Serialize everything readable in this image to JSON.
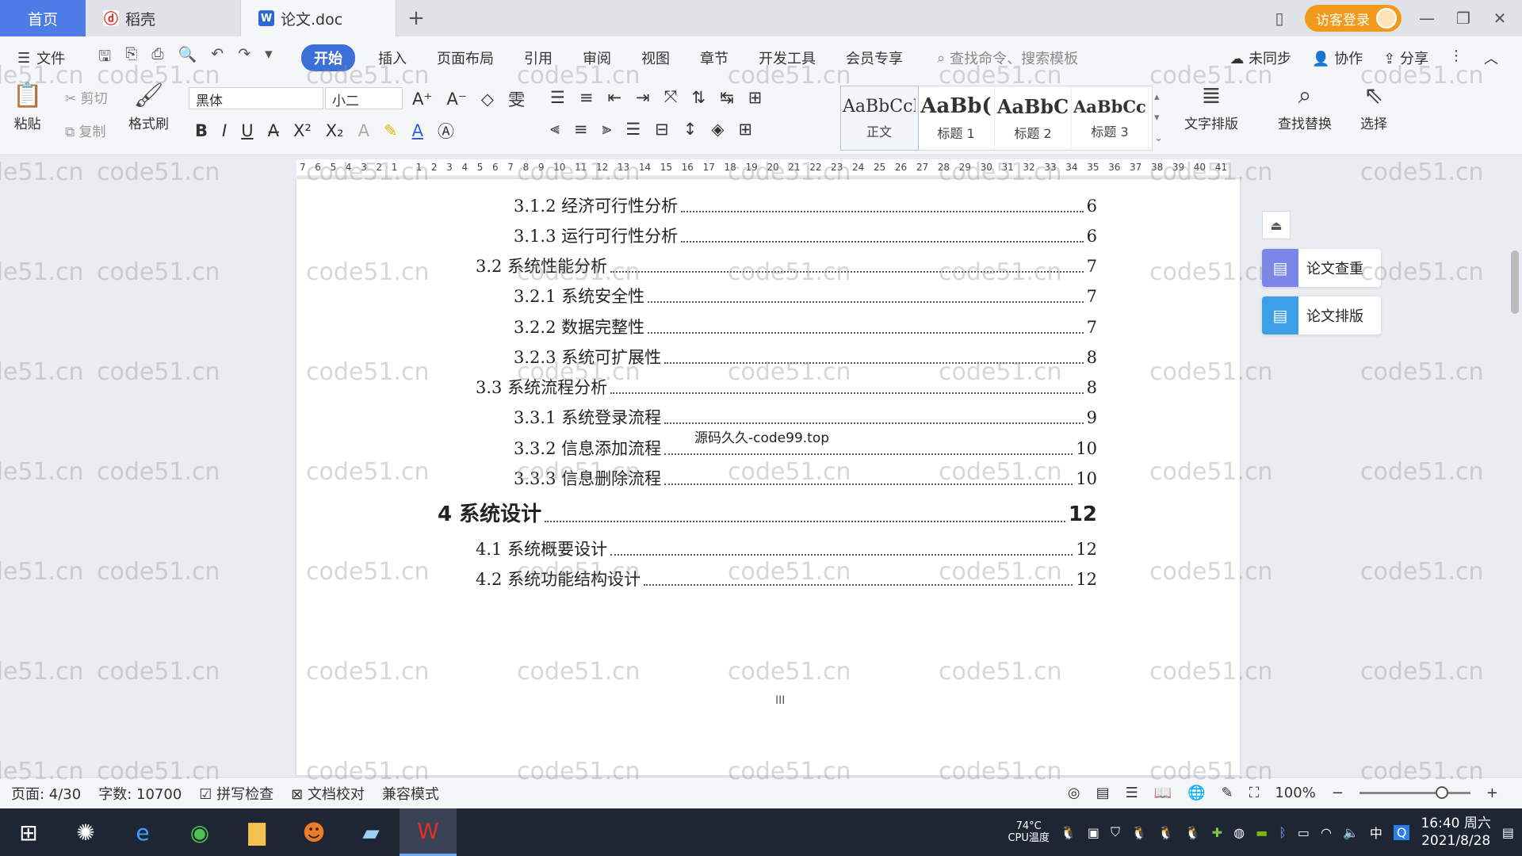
{
  "tabs": {
    "home": "首页",
    "docer": "稻壳",
    "doc": "论文.doc",
    "login": "访客登录"
  },
  "menu": {
    "file": "文件",
    "items": [
      "开始",
      "插入",
      "页面布局",
      "引用",
      "审阅",
      "视图",
      "章节",
      "开发工具",
      "会员专享"
    ],
    "search_placeholder": "查找命令、搜索模板",
    "unsynced": "未同步",
    "collab": "协作",
    "share": "分享"
  },
  "ribbon": {
    "paste": "粘贴",
    "cut": "剪切",
    "copy": "复制",
    "format_painter": "格式刷",
    "font": "黑体",
    "size": "小二",
    "styles": [
      {
        "sample": "AaBbCcI",
        "name": "正文"
      },
      {
        "sample": "AaBb(",
        "name": "标题 1"
      },
      {
        "sample": "AaBbC",
        "name": "标题 2"
      },
      {
        "sample": "AaBbCcI",
        "name": "标题 3"
      }
    ],
    "text_layout": "文字排版",
    "find_replace": "查找替换",
    "select": "选择"
  },
  "ruler": [
    "7",
    "6",
    "5",
    "4",
    "3",
    "2",
    "1",
    "",
    "1",
    "2",
    "3",
    "4",
    "5",
    "6",
    "7",
    "8",
    "9",
    "10",
    "11",
    "12",
    "13",
    "14",
    "15",
    "16",
    "17",
    "18",
    "19",
    "20",
    "21",
    "22",
    "23",
    "24",
    "25",
    "26",
    "27",
    "28",
    "29",
    "30",
    "31",
    "32",
    "33",
    "34",
    "35",
    "36",
    "37",
    "38",
    "39",
    "40",
    "41"
  ],
  "toc": [
    {
      "text": "3.1.2  经济可行性分析",
      "page": "6",
      "level": 3
    },
    {
      "text": "3.1.3  运行可行性分析",
      "page": "6",
      "level": 3
    },
    {
      "text": "3.2 系统性能分析",
      "page": "7",
      "level": 2
    },
    {
      "text": "3.2.1  系统安全性",
      "page": "7",
      "level": 3
    },
    {
      "text": "3.2.2  数据完整性",
      "page": "7",
      "level": 3
    },
    {
      "text": "3.2.3 系统可扩展性",
      "page": "8",
      "level": 3
    },
    {
      "text": "3.3 系统流程分析",
      "page": "8",
      "level": 2
    },
    {
      "text": "3.3.1 系统登录流程",
      "page": "9",
      "level": 3
    },
    {
      "text": "3.3.2 信息添加流程",
      "page": "10",
      "level": 3
    },
    {
      "text": "3.3.3 信息删除流程",
      "page": "10",
      "level": 3
    },
    {
      "text": "4  系统设计",
      "page": "12",
      "level": 1
    },
    {
      "text": "4.1 系统概要设计",
      "page": "12",
      "level": 2
    },
    {
      "text": "4.2 系统功能结构设计",
      "page": "12",
      "level": 2
    }
  ],
  "page_footer": "III",
  "center_mark": "源码久久-code99.top",
  "watermark": "code51.cn",
  "side_panel": {
    "check": "论文查重",
    "layout": "论文排版"
  },
  "status": {
    "page": "页面: 4/30",
    "words": "字数: 10700",
    "spell": "拼写检查",
    "proof": "文档校对",
    "compat": "兼容模式",
    "zoom": "100%"
  },
  "taskbar": {
    "cpu_temp": "74°C",
    "cpu_label": "CPU温度",
    "ime": "中",
    "time": "16:40 周六",
    "date": "2021/8/28"
  }
}
